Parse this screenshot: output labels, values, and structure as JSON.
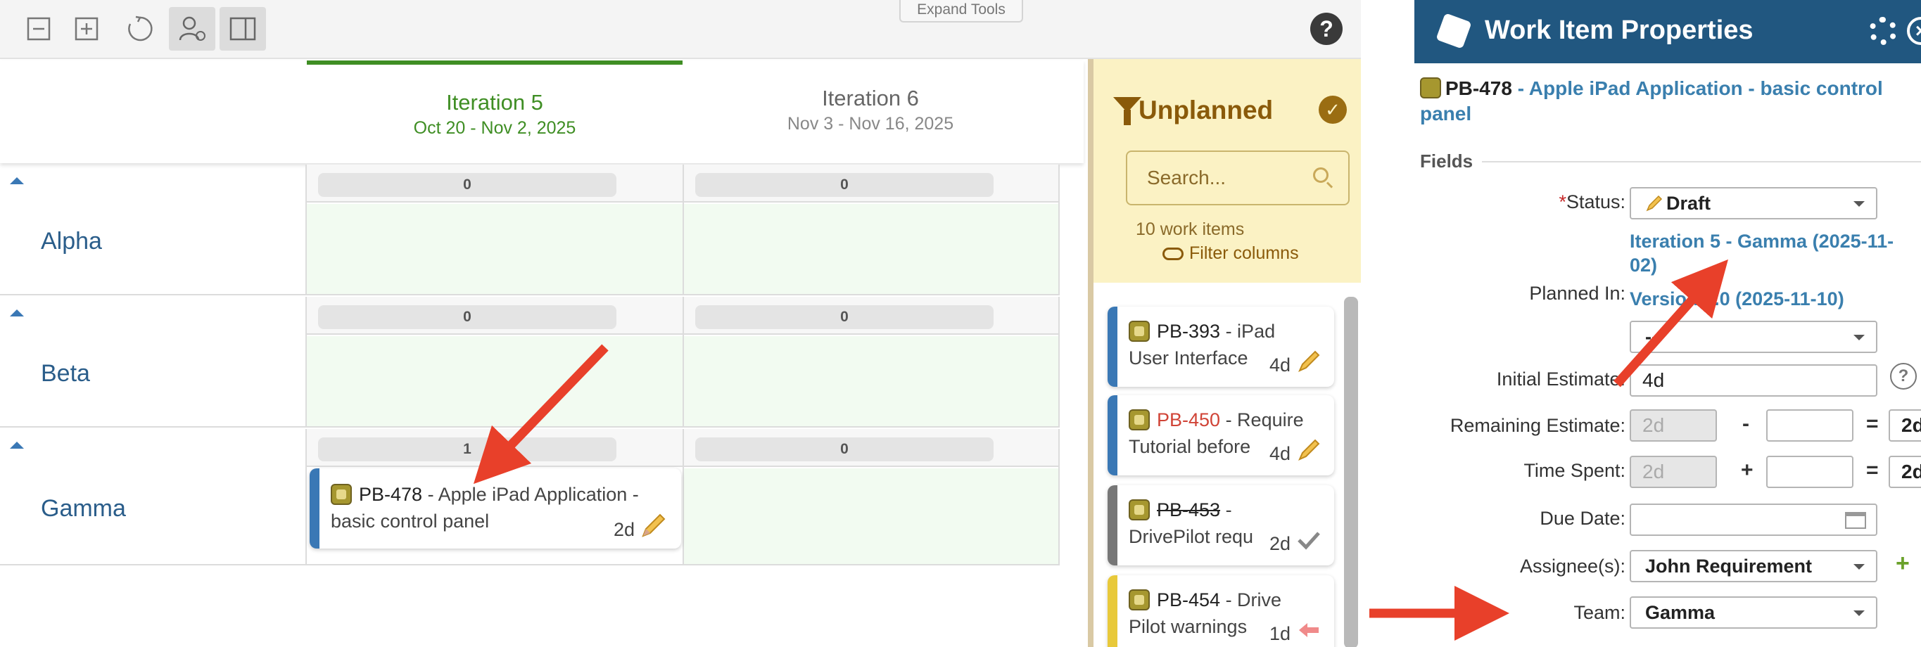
{
  "toolbar": {
    "expand_tools_label": "Expand Tools",
    "help_label": "?"
  },
  "iterations": [
    {
      "name": "Iteration 5",
      "dates": "Oct 20 - Nov 2, 2025"
    },
    {
      "name": "Iteration 6",
      "dates": "Nov 3 - Nov 16, 2025"
    }
  ],
  "teams": [
    {
      "name": "Alpha",
      "counts": [
        "0",
        "0"
      ]
    },
    {
      "name": "Beta",
      "counts": [
        "0",
        "0"
      ]
    },
    {
      "name": "Gamma",
      "counts": [
        "1",
        "0"
      ]
    }
  ],
  "planned_card": {
    "key": "PB-478",
    "title": " - Apple iPad Application - basic control panel",
    "line1": " - Apple iPad Application -",
    "line2": "basic control panel",
    "estimate": "2d"
  },
  "unplanned": {
    "title": "Unplanned",
    "search_placeholder": "Search...",
    "count_text": "10 work items",
    "filter_label": "Filter columns",
    "cards": [
      {
        "key": "PB-393",
        "line1": " - iPad",
        "line2": "User Interface",
        "estimate": "4d",
        "stripe": "#3a78b5",
        "key_color": "#222",
        "strike": false,
        "status_icon": "pencil-icon"
      },
      {
        "key": "PB-450",
        "line1": " - Require",
        "line2": "Tutorial before",
        "estimate": "4d",
        "stripe": "#3a78b5",
        "key_color": "#d04437",
        "strike": false,
        "status_icon": "pencil-icon"
      },
      {
        "key": "PB-453",
        "line1": " -",
        "line2": "DrivePilot requ",
        "estimate": "2d",
        "stripe": "#777777",
        "key_color": "#222",
        "strike": true,
        "status_icon": "check-icon"
      },
      {
        "key": "PB-454",
        "line1": " - Drive",
        "line2": "Pilot warnings",
        "estimate": "1d",
        "stripe": "#e8c93a",
        "key_color": "#222",
        "strike": false,
        "status_icon": "back-arrow-icon"
      }
    ]
  },
  "properties": {
    "panel_title": "Work Item Properties",
    "item_key": "PB-478",
    "item_title": " - Apple iPad Application - basic control panel",
    "fields_heading": "Fields",
    "status_label": "Status:",
    "status_required_mark": "*",
    "status_value": "Draft",
    "planned_in_label": "Planned In:",
    "planned_in_iteration": "Iteration 5 - Gamma (2025-11-02)",
    "planned_in_iteration_line1": "Iteration 5 - Gamma (2025-11-",
    "planned_in_iteration_line2": "02)",
    "planned_in_version": "Version 3.0 (2025-11-10)",
    "planned_in_select": "--",
    "initial_estimate_label": "Initial Estimate:",
    "initial_estimate_value": "4d",
    "remaining_estimate_label": "Remaining Estimate:",
    "remaining_a": "2d",
    "remaining_op": "-",
    "remaining_b": "",
    "remaining_eq": "=",
    "remaining_result": "2d",
    "time_spent_label": "Time Spent:",
    "spent_a": "2d",
    "spent_op": "+",
    "spent_b": "",
    "spent_eq": "=",
    "spent_result": "2d",
    "due_date_label": "Due Date:",
    "due_date_value": "",
    "assignee_label": "Assignee(s):",
    "assignee_value": "John Requirement",
    "team_label": "Team:",
    "team_value": "Gamma"
  },
  "colors": {
    "accent_green": "#3f8e24",
    "header_blue": "#215780",
    "annotation_red": "#e8402a",
    "unplanned_bg": "#fbf2c4"
  }
}
